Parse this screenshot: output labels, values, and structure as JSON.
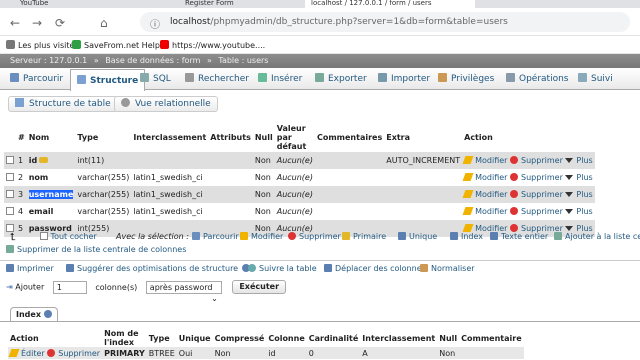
{
  "browser": {
    "tabs": [
      {
        "label": "YouTube"
      },
      {
        "label": "Register Form"
      },
      {
        "label": "localhost / 127.0.0.1 / form / users"
      }
    ],
    "url_host": "localhost",
    "url_path": "/phpmyadmin/db_structure.php?server=1&db=form&table=users",
    "bookmarks": [
      {
        "label": "Les plus visités"
      },
      {
        "label": "SaveFrom.net Helper"
      },
      {
        "label": "https://www.youtube...."
      }
    ]
  },
  "pma": {
    "breadcrumb": {
      "server": "Serveur : 127.0.0.1",
      "db": "Base de données : form",
      "table": "Table : users"
    },
    "menu": [
      "Parcourir",
      "Structure",
      "SQL",
      "Rechercher",
      "Insérer",
      "Exporter",
      "Importer",
      "Privilèges",
      "Opérations",
      "Suivi"
    ],
    "subtabs": {
      "structure": "Structure de table",
      "relational": "Vue relationnelle"
    },
    "columns_header": [
      "#",
      "Nom",
      "Type",
      "Interclassement",
      "Attributs",
      "Null",
      "Valeur par défaut",
      "Commentaires",
      "Extra",
      "Action"
    ],
    "rows": [
      {
        "num": "1",
        "name": "id",
        "type": "int(11)",
        "collation": "",
        "null": "Non",
        "default": "Aucun(e)",
        "extra": "AUTO_INCREMENT"
      },
      {
        "num": "2",
        "name": "nom",
        "type": "varchar(255)",
        "collation": "latin1_swedish_ci",
        "null": "Non",
        "default": "Aucun(e)",
        "extra": ""
      },
      {
        "num": "3",
        "name": "username",
        "type": "varchar(255)",
        "collation": "latin1_swedish_ci",
        "null": "Non",
        "default": "Aucun(e)",
        "extra": ""
      },
      {
        "num": "4",
        "name": "email",
        "type": "varchar(255)",
        "collation": "latin1_swedish_ci",
        "null": "Non",
        "default": "Aucun(e)",
        "extra": ""
      },
      {
        "num": "5",
        "name": "password",
        "type": "int(255)",
        "collation": "",
        "null": "Non",
        "default": "Aucun(e)",
        "extra": ""
      }
    ],
    "actions": {
      "modify": "Modifier",
      "delete": "Supprimer",
      "more": "Plus"
    },
    "bulk": {
      "check_all": "Tout cocher",
      "with_selection": "Avec la sélection :",
      "items": [
        "Parcourir",
        "Modifier",
        "Supprimer",
        "Primaire",
        "Unique",
        "Index",
        "Texte entier",
        "Ajouter à la liste centrale"
      ],
      "remove_central": "Supprimer de la liste centrale de colonnes"
    },
    "tools": [
      "Imprimer",
      "Suggérer des optimisations de structure",
      "Suivre la table",
      "Déplacer des colonnes",
      "Normaliser"
    ],
    "add": {
      "label": "Ajouter",
      "count": "1",
      "cols": "colonne(s)",
      "position": "après password",
      "exec": "Exécuter"
    },
    "index": {
      "title": "Index",
      "headers": [
        "Action",
        "Nom de l'index",
        "Type",
        "Unique",
        "Compressé",
        "Colonne",
        "Cardinalité",
        "Interclassement",
        "Null",
        "Commentaire"
      ],
      "rows": [
        {
          "edit": "Éditer",
          "del": "Supprimer",
          "name": "PRIMARY",
          "type": "BTREE",
          "unique": "Oui",
          "packed": "Non",
          "column": "id",
          "card": "0",
          "coll": "A",
          "null": "Non",
          "comment": ""
        }
      ]
    }
  }
}
